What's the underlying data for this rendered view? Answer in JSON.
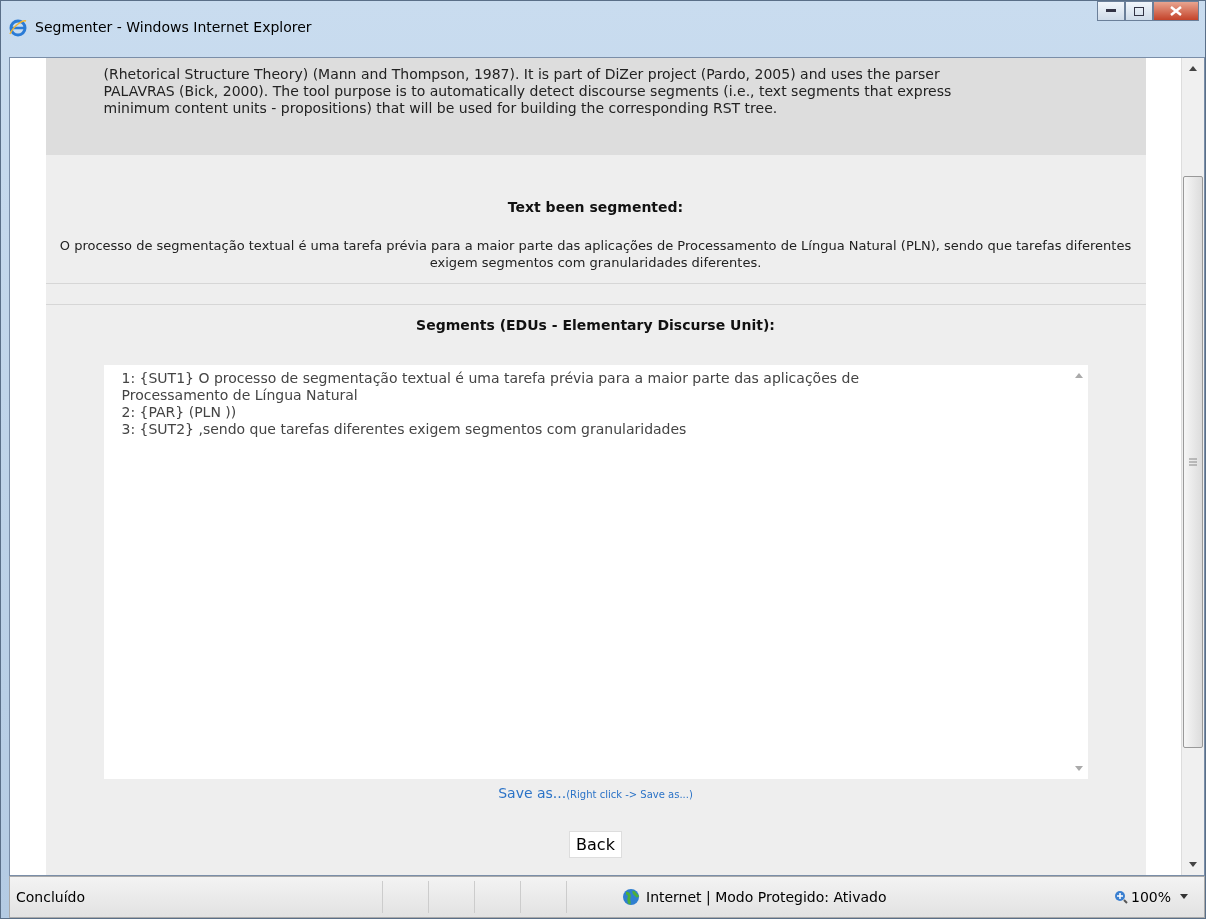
{
  "window": {
    "title": "Segmenter - Windows Internet Explorer"
  },
  "intro": {
    "lines": [
      "(Rhetorical Structure Theory) (Mann and Thompson, 1987). It is part of DiZer project (Pardo, 2005) and uses the parser",
      "PALAVRAS (Bick, 2000). The tool purpose is to automatically detect discourse segments (i.e., text segments that express",
      "minimum content units - propositions) that will be used for building the corresponding RST tree."
    ]
  },
  "source": {
    "heading": "Text been segmented:",
    "text": "O processo de segmentação textual é uma tarefa prévia para a maior parte das aplicações de Processamento de Língua Natural (PLN), sendo que tarefas diferentes exigem segmentos com granularidades diferentes."
  },
  "segments": {
    "heading": "Segments (EDUs - Elementary Discurse Unit):",
    "lines": [
      "1: {SUT1} O processo de segmentação textual é uma tarefa prévia para a maior parte das aplicações de",
      "Processamento de Língua Natural",
      "2: {PAR} (PLN ))",
      "3: {SUT2} ,sendo que tarefas diferentes exigem segmentos com granularidades"
    ]
  },
  "save_link": {
    "label": "Save as...",
    "hint": "(Right click -> Save as...)"
  },
  "back_button": "Back",
  "status_bar": {
    "status": "Concluído",
    "zone": "Internet | Modo Protegido: Ativado",
    "zoom": "100%"
  }
}
